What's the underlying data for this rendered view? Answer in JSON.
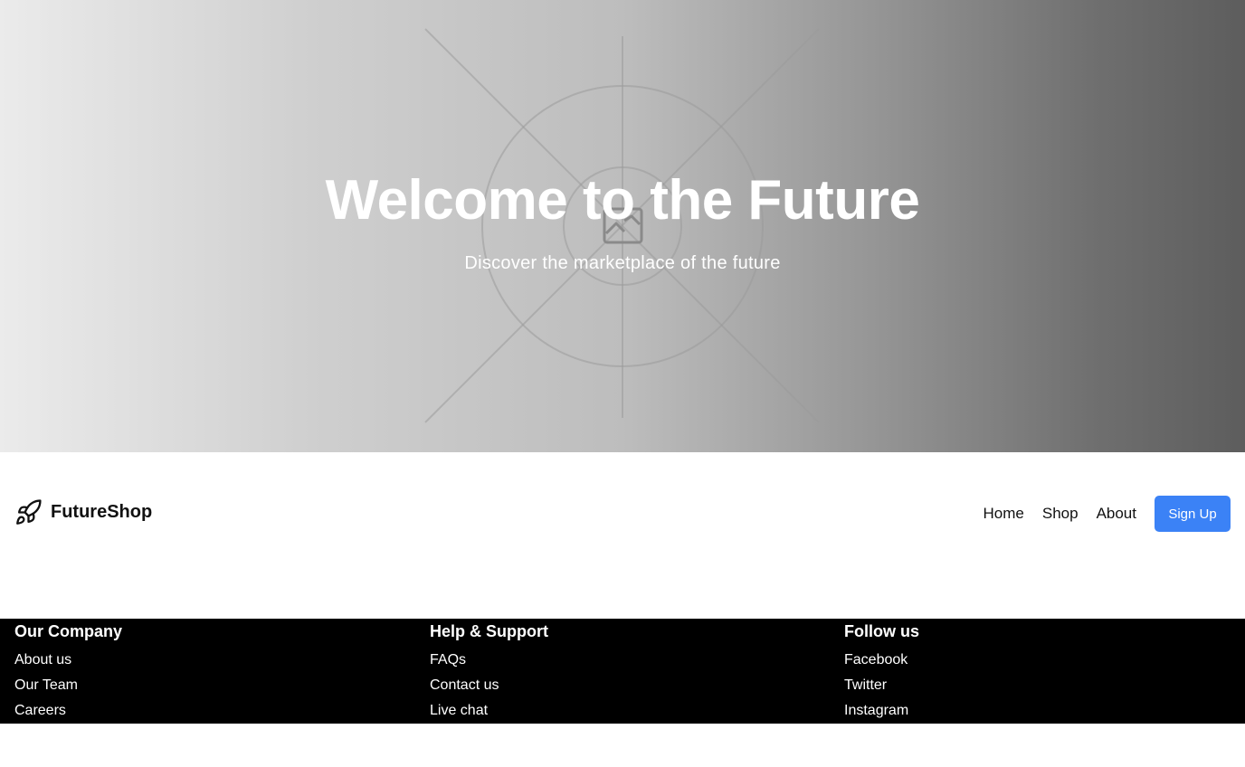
{
  "hero": {
    "title": "Welcome to the Future",
    "subtitle": "Discover the marketplace of the future",
    "background_icon": "image-placeholder-icon"
  },
  "header": {
    "brand_name": "FutureShop",
    "brand_icon": "rocket-icon",
    "nav": [
      {
        "label": "Home"
      },
      {
        "label": "Shop"
      },
      {
        "label": "About"
      }
    ],
    "cta_label": "Sign Up"
  },
  "footer": {
    "columns": [
      {
        "title": "Our Company",
        "links": [
          "About us",
          "Our Team",
          "Careers"
        ]
      },
      {
        "title": "Help & Support",
        "links": [
          "FAQs",
          "Contact us",
          "Live chat"
        ]
      },
      {
        "title": "Follow us",
        "links": [
          "Facebook",
          "Twitter",
          "Instagram"
        ]
      }
    ]
  },
  "colors": {
    "accent": "#3b82f6",
    "footer_bg": "#000000",
    "hero_text": "#ffffff"
  }
}
